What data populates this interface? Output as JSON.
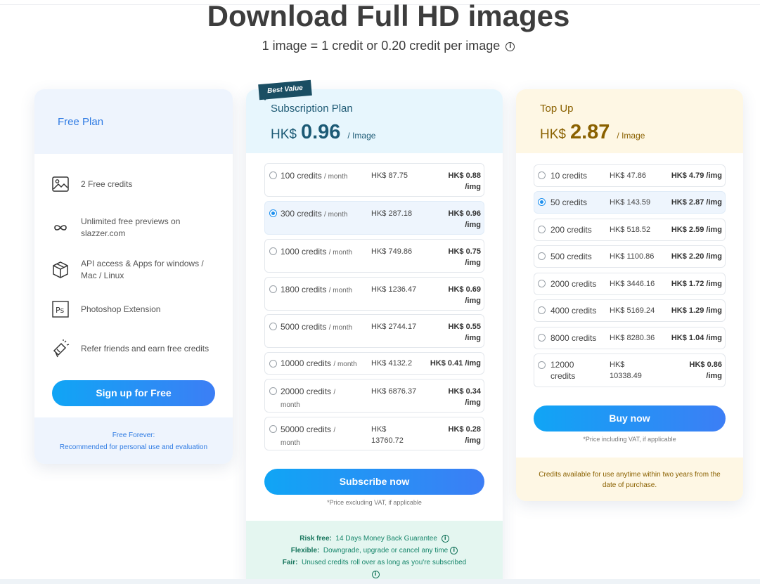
{
  "page": {
    "title": "Download Full HD images",
    "subtitle": "1 image = 1 credit or 0.20 credit per image"
  },
  "free_plan": {
    "title": "Free Plan",
    "features": [
      {
        "icon": "image-icon",
        "text": "2 Free credits"
      },
      {
        "icon": "infinity-icon",
        "text": "Unlimited free previews on slazzer.com"
      },
      {
        "icon": "cube-icon",
        "text": "API access & Apps for windows / Mac / Linux"
      },
      {
        "icon": "photoshop-icon",
        "text": "Photoshop Extension"
      },
      {
        "icon": "megaphone-icon",
        "text": "Refer friends and earn free credits"
      }
    ],
    "button_label": "Sign up for Free",
    "footer_line1": "Free Forever:",
    "footer_line2": "Recommended for personal use and evaluation"
  },
  "subscription_plan": {
    "badge": "Best Value",
    "title": "Subscription Plan",
    "currency": "HK$",
    "price": "0.96",
    "unit": "/ Image",
    "per_month": "/ month",
    "rows": [
      {
        "credits": "100 credits",
        "price": "HK$ 87.75",
        "per_img": "HK$ 0.88 /img",
        "selected": false
      },
      {
        "credits": "300 credits",
        "price": "HK$ 287.18",
        "per_img": "HK$ 0.96 /img",
        "selected": true
      },
      {
        "credits": "1000 credits",
        "price": "HK$ 749.86",
        "per_img": "HK$ 0.75 /img",
        "selected": false
      },
      {
        "credits": "1800 credits",
        "price": "HK$ 1236.47",
        "per_img": "HK$ 0.69 /img",
        "selected": false
      },
      {
        "credits": "5000 credits",
        "price": "HK$ 2744.17",
        "per_img": "HK$ 0.55 /img",
        "selected": false
      },
      {
        "credits": "10000 credits",
        "price": "HK$ 4132.2",
        "per_img": "HK$ 0.41 /img",
        "selected": false
      },
      {
        "credits": "20000 credits",
        "price": "HK$ 6876.37",
        "per_img": "HK$ 0.34 /img",
        "selected": false
      },
      {
        "credits": "50000 credits",
        "price": "HK$ 13760.72",
        "per_img": "HK$ 0.28 /img",
        "selected": false
      }
    ],
    "button_label": "Subscribe now",
    "note": "*Price excluding VAT, if applicable",
    "footer": [
      {
        "label": "Risk free:",
        "text": "14 Days Money Back Guarantee"
      },
      {
        "label": "Flexible:",
        "text": "Downgrade, upgrade or cancel any time"
      },
      {
        "label": "Fair:",
        "text": "Unused credits roll over as long as you're subscribed"
      }
    ]
  },
  "top_up": {
    "title": "Top Up",
    "currency": "HK$",
    "price": "2.87",
    "unit": "/ Image",
    "rows": [
      {
        "credits": "10 credits",
        "price": "HK$ 47.86",
        "per_img": "HK$ 4.79 /img",
        "selected": false
      },
      {
        "credits": "50 credits",
        "price": "HK$ 143.59",
        "per_img": "HK$ 2.87 /img",
        "selected": true
      },
      {
        "credits": "200 credits",
        "price": "HK$ 518.52",
        "per_img": "HK$ 2.59 /img",
        "selected": false
      },
      {
        "credits": "500 credits",
        "price": "HK$ 1100.86",
        "per_img": "HK$ 2.20 /img",
        "selected": false
      },
      {
        "credits": "2000 credits",
        "price": "HK$ 3446.16",
        "per_img": "HK$ 1.72 /img",
        "selected": false
      },
      {
        "credits": "4000 credits",
        "price": "HK$ 5169.24",
        "per_img": "HK$ 1.29 /img",
        "selected": false
      },
      {
        "credits": "8000 credits",
        "price": "HK$ 8280.36",
        "per_img": "HK$ 1.04 /img",
        "selected": false
      },
      {
        "credits": "12000 credits",
        "price": "HK$ 10338.49",
        "per_img": "HK$ 0.86 /img",
        "selected": false
      }
    ],
    "button_label": "Buy now",
    "note": "*Price including VAT, if applicable",
    "footer": "Credits available for use anytime within two years from the date of purchase."
  },
  "colors": {
    "accent": "#2f7be3",
    "button_start": "#10a5f5",
    "button_end": "#3c7ef5",
    "subscription_brand": "#1c5a75",
    "topup_brand": "#8a6100"
  }
}
